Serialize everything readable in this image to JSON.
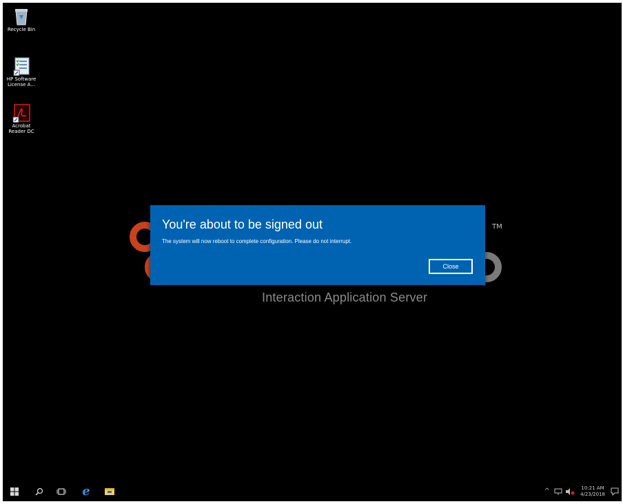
{
  "desktop": {
    "icons": [
      {
        "label": "Recycle Bin",
        "icon": "recycle-bin-icon"
      },
      {
        "label": "HP Software License A...",
        "icon": "license-document-icon"
      },
      {
        "label": "Acrobat Reader DC",
        "icon": "acrobat-reader-icon"
      }
    ],
    "background": {
      "trademark": "TM",
      "product_name": "Interaction Application Server"
    }
  },
  "dialog": {
    "title": "You're about to be signed out",
    "message": "The system will now reboot to complete configuration. Please do not interrupt.",
    "close_label": "Close",
    "accent": "#0063b1"
  },
  "taskbar": {
    "items": [
      "windows-start-icon",
      "search-icon",
      "task-view-icon",
      "edge-browser-icon",
      "file-explorer-icon"
    ],
    "tray": [
      "show-hidden-icons-chevron",
      "network-icon",
      "volume-muted-icon",
      "notification-icon"
    ],
    "clock": {
      "time": "10:21 AM",
      "date": "4/23/2018"
    }
  }
}
